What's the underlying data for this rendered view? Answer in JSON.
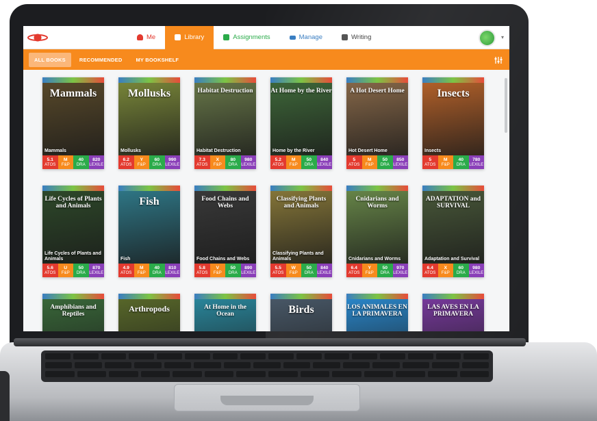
{
  "nav": {
    "tabs": [
      {
        "label": "Me",
        "icon": "person-icon",
        "color": "#e33a2f"
      },
      {
        "label": "Library",
        "icon": "book-icon",
        "color": "#ffffff"
      },
      {
        "label": "Assignments",
        "icon": "clipboard-icon",
        "color": "#2bab4a"
      },
      {
        "label": "Manage",
        "icon": "graduation-cap-icon",
        "color": "#3a7ec2"
      },
      {
        "label": "Writing",
        "icon": "pencil-icon",
        "color": "#444444"
      }
    ],
    "active_tab": "Library",
    "accent": "#f78a1d"
  },
  "subnav": {
    "tabs": [
      "ALL BOOKS",
      "RECOMMENDED",
      "MY BOOKSHELF"
    ],
    "active": "ALL BOOKS"
  },
  "level_labels": {
    "atos": "ATOS",
    "fp": "F&P",
    "dra": "DRA",
    "lexile": "LEXILE"
  },
  "books": [
    {
      "cover_title": "Mammals",
      "caption": "Mammals",
      "atos": "5.1",
      "fp": "M",
      "dra": "40",
      "lexile": "820",
      "bg": "#5a4a2a"
    },
    {
      "cover_title": "Mollusks",
      "caption": "Mollusks",
      "atos": "6.2",
      "fp": "Y",
      "dra": "60",
      "lexile": "990",
      "bg": "#7c8a3a"
    },
    {
      "cover_title": "Habitat Destruction",
      "caption": "Habitat Destruction",
      "atos": "7.3",
      "fp": "X",
      "dra": "80",
      "lexile": "980",
      "bg": "#6a7a4a"
    },
    {
      "cover_title": "At Home by the River",
      "caption": "Home by the River",
      "atos": "5.2",
      "fp": "M",
      "dra": "50",
      "lexile": "840",
      "bg": "#3f6a3a"
    },
    {
      "cover_title": "A Hot Desert Home",
      "caption": "Hot Desert Home",
      "atos": "5",
      "fp": "M",
      "dra": "50",
      "lexile": "850",
      "bg": "#8a6a4a"
    },
    {
      "cover_title": "Insects",
      "caption": "Insects",
      "atos": "5",
      "fp": "M",
      "dra": "40",
      "lexile": "780",
      "bg": "#b8632a"
    },
    {
      "cover_title": "Life Cycles of Plants and Animals",
      "caption": "Life Cycles of Plants and Animals",
      "atos": "5.6",
      "fp": "U",
      "dra": "50",
      "lexile": "870",
      "bg": "#2e4a2a"
    },
    {
      "cover_title": "Fish",
      "caption": "Fish",
      "atos": "4.9",
      "fp": "M",
      "dra": "40",
      "lexile": "810",
      "bg": "#2f7a8a"
    },
    {
      "cover_title": "Food Chains and Webs",
      "caption": "Food Chains and Webs",
      "atos": "5.8",
      "fp": "V",
      "dra": "50",
      "lexile": "890",
      "bg": "#3a3a3a"
    },
    {
      "cover_title": "Classifying Plants and Animals",
      "caption": "Classifying Plants and Animals",
      "atos": "5.5",
      "fp": "W",
      "dra": "50",
      "lexile": "840",
      "bg": "#8a7a3a"
    },
    {
      "cover_title": "Cnidarians and Worms",
      "caption": "Cnidarians and Worms",
      "atos": "6.4",
      "fp": "Y",
      "dra": "50",
      "lexile": "970",
      "bg": "#6a8a4a"
    },
    {
      "cover_title": "ADAPTATION and SURVIVAL",
      "caption": "Adaptation and Survival",
      "atos": "6.4",
      "fp": "X",
      "dra": "60",
      "lexile": "980",
      "bg": "#4a5a3a"
    },
    {
      "cover_title": "Amphibians and Reptiles",
      "caption": "",
      "atos": "",
      "fp": "",
      "dra": "",
      "lexile": "",
      "bg": "#3a6a3a"
    },
    {
      "cover_title": "Arthropods",
      "caption": "",
      "atos": "",
      "fp": "",
      "dra": "",
      "lexile": "",
      "bg": "#5a6a2a"
    },
    {
      "cover_title": "At Home in the Ocean",
      "caption": "",
      "atos": "",
      "fp": "",
      "dra": "",
      "lexile": "",
      "bg": "#2a8aa0"
    },
    {
      "cover_title": "Birds",
      "caption": "",
      "atos": "",
      "fp": "",
      "dra": "",
      "lexile": "",
      "bg": "#4a5a6a"
    },
    {
      "cover_title": "LOS ANIMALES EN LA PRIMAVERA",
      "caption": "",
      "atos": "",
      "fp": "",
      "dra": "",
      "lexile": "",
      "bg": "#2a8ad0"
    },
    {
      "cover_title": "LAS AVES EN LA PRIMAVERA",
      "caption": "",
      "atos": "",
      "fp": "",
      "dra": "",
      "lexile": "",
      "bg": "#7a3aa0"
    }
  ]
}
